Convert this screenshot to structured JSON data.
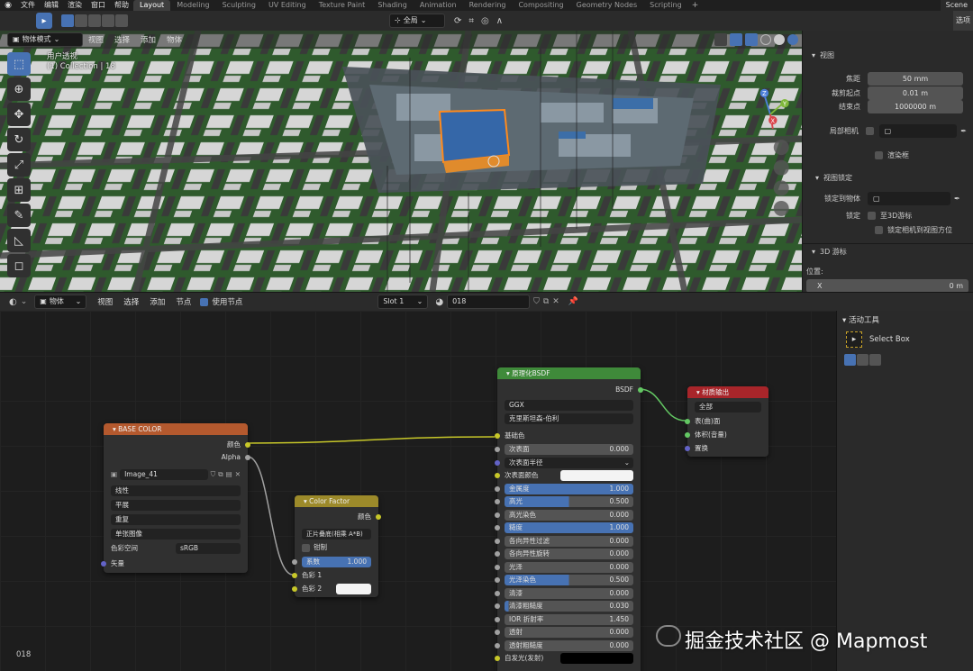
{
  "topbar": {
    "menus": [
      "文件",
      "编辑",
      "渲染",
      "窗口",
      "帮助"
    ],
    "workspaces": [
      "Layout",
      "Modeling",
      "Sculpting",
      "UV Editing",
      "Texture Paint",
      "Shading",
      "Animation",
      "Rendering",
      "Compositing",
      "Geometry Nodes",
      "Scripting"
    ],
    "active_workspace": "Layout",
    "scene": "Scene",
    "options": "选项"
  },
  "viewport": {
    "mode": "物体模式",
    "menus": [
      "视图",
      "选择",
      "添加",
      "物体"
    ],
    "transform_orientation": "全局",
    "view_name": "用户透视",
    "collection": "(1) Collection | 18",
    "gizmo": {
      "z": "Z",
      "y": "Y",
      "x": "X"
    }
  },
  "npanel": {
    "view_header": "视图",
    "focal_label": "焦距",
    "focal_value": "50 mm",
    "clip_start_label": "裁剪起点",
    "clip_start_value": "0.01 m",
    "clip_end_label": "结束点",
    "clip_end_value": "1000000 m",
    "local_camera_label": "局部相机",
    "render_region_label": "渲染框",
    "view_lock_header": "视图锁定",
    "lock_to_object_label": "锁定到物体",
    "lock_label": "锁定",
    "lock_3d_cursor": "至3D游标",
    "lock_camera_to_view": "锁定相机到视图方位",
    "cursor_header": "3D 游标",
    "location_label": "位置:",
    "x_label": "X",
    "x_value": "0 m"
  },
  "node_header": {
    "object_type": "物体",
    "menus": [
      "视图",
      "选择",
      "添加",
      "节点"
    ],
    "use_nodes": "使用节点",
    "slot": "Slot 1",
    "material": "018"
  },
  "tool_panel": {
    "header": "活动工具",
    "tool": "Select Box"
  },
  "nodes": {
    "base_color": {
      "title": "BASE COLOR",
      "out_color": "颜色",
      "out_alpha": "Alpha",
      "image": "Image_41",
      "interpolation": "线性",
      "projection": "平展",
      "extension": "重复",
      "source": "单张图像",
      "colorspace_label": "色彩空间",
      "colorspace": "sRGB",
      "in_vector": "矢量"
    },
    "color_factor": {
      "title": "Color Factor",
      "out_color": "颜色",
      "blend": "正片叠底(相乘 A*B)",
      "clamp": "钳制",
      "fac_label": "系数",
      "fac_value": "1.000",
      "color1": "色彩 1",
      "color2": "色彩 2"
    },
    "bsdf": {
      "title": "原理化BSDF",
      "out": "BSDF",
      "distribution": "GGX",
      "subsurface_method": "克里斯坦森-伯利",
      "base_color": "基础色",
      "rows": [
        {
          "label": "次表面",
          "value": "0.000",
          "fill": 0
        },
        {
          "label": "次表面半径",
          "value": "",
          "fill": 0,
          "dropdown": true
        },
        {
          "label": "次表面颜色",
          "value": "",
          "fill": 0,
          "swatch": "#f4f4f4"
        },
        {
          "label": "金属度",
          "value": "1.000",
          "fill": 100
        },
        {
          "label": "高光",
          "value": "0.500",
          "fill": 50
        },
        {
          "label": "高光染色",
          "value": "0.000",
          "fill": 0
        },
        {
          "label": "糙度",
          "value": "1.000",
          "fill": 100
        },
        {
          "label": "各向异性过滤",
          "value": "0.000",
          "fill": 0
        },
        {
          "label": "各向异性旋转",
          "value": "0.000",
          "fill": 0
        },
        {
          "label": "光泽",
          "value": "0.000",
          "fill": 0
        },
        {
          "label": "光泽染色",
          "value": "0.500",
          "fill": 50
        },
        {
          "label": "清漆",
          "value": "0.000",
          "fill": 0
        },
        {
          "label": "清漆粗糙度",
          "value": "0.030",
          "fill": 3
        },
        {
          "label": "IOR 折射率",
          "value": "1.450",
          "fill": 0
        },
        {
          "label": "透射",
          "value": "0.000",
          "fill": 0
        },
        {
          "label": "透射粗糙度",
          "value": "0.000",
          "fill": 0
        },
        {
          "label": "自发光(发射)",
          "value": "",
          "fill": 0,
          "swatch": "#000000"
        }
      ]
    },
    "output": {
      "title": "材质输出",
      "target": "全部",
      "surface": "表(曲)面",
      "volume": "体积(音量)",
      "displacement": "置换"
    }
  },
  "frame": "018",
  "watermark": "掘金技术社区 @ Mapmost",
  "colors": {
    "accent": "#4772b3",
    "node_image_header": "#b4592e",
    "node_mix_header": "#9c8a2a",
    "node_shader_header": "#3f8a3a",
    "node_output_header": "#a8252a"
  }
}
